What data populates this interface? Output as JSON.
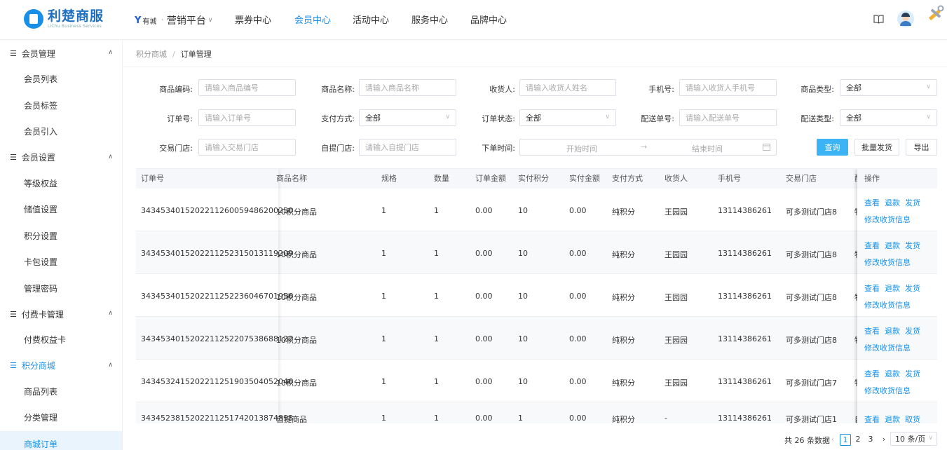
{
  "header": {
    "logo_text": "利楚商服",
    "logo_sub": "LiChu Business Services",
    "brand_mark": "Y",
    "brand_name": "有城",
    "platform": "营销平台",
    "nav": [
      "票券中心",
      "会员中心",
      "活动中心",
      "服务中心",
      "品牌中心"
    ],
    "active_nav": "会员中心",
    "icons": [
      "book-icon",
      "avatar",
      "tools-icon"
    ]
  },
  "sidebar": {
    "groups": [
      {
        "label": "会员管理",
        "items": [
          "会员列表",
          "会员标签",
          "会员引入"
        ]
      },
      {
        "label": "会员设置",
        "items": [
          "等级权益",
          "储值设置",
          "积分设置",
          "卡包设置",
          "管理密码"
        ]
      },
      {
        "label": "付费卡管理",
        "items": [
          "付费权益卡"
        ]
      },
      {
        "label": "积分商城",
        "items": [
          "商品列表",
          "分类管理",
          "商城订单"
        ]
      }
    ],
    "active_group": "积分商城",
    "active_item": "商城订单"
  },
  "breadcrumb": {
    "parent": "积分商城",
    "separator": "/",
    "current": "订单管理"
  },
  "filters": {
    "goods_code": {
      "label": "商品编码:",
      "placeholder": "请输入商品编号"
    },
    "goods_name": {
      "label": "商品名称:",
      "placeholder": "请输入商品名称"
    },
    "receiver": {
      "label": "收货人:",
      "placeholder": "请输入收货人姓名"
    },
    "phone": {
      "label": "手机号:",
      "placeholder": "请输入收货人手机号"
    },
    "goods_type": {
      "label": "商品类型:",
      "value": "全部"
    },
    "order_no": {
      "label": "订单号:",
      "placeholder": "请输入订单号"
    },
    "pay_method": {
      "label": "支付方式:",
      "value": "全部"
    },
    "order_status": {
      "label": "订单状态:",
      "value": "全部"
    },
    "delivery_no": {
      "label": "配送单号:",
      "placeholder": "请输入配送单号"
    },
    "delivery_type": {
      "label": "配送类型:",
      "value": "全部"
    },
    "trade_store": {
      "label": "交易门店:",
      "placeholder": "请输入交易门店"
    },
    "pickup_store": {
      "label": "自提门店:",
      "placeholder": "请输入自提门店"
    },
    "order_time": {
      "label": "下单时间:",
      "start": "开始时间",
      "arrow": "→",
      "end": "结束时间"
    }
  },
  "buttons": {
    "query": "查询",
    "batch_ship": "批量发货",
    "export": "导出"
  },
  "table": {
    "columns": [
      "订单号",
      "商品名称",
      "规格",
      "数量",
      "订单金额",
      "实付积分",
      "实付金额",
      "支付方式",
      "收货人",
      "手机号",
      "交易门店",
      "配送",
      "操作"
    ],
    "rows": [
      [
        "343453401520221126005948620025​0",
        "10积分商品",
        "1",
        "1",
        "0.00",
        "10",
        "0.00",
        "纯积分",
        "王园园",
        "13114386261",
        "可多测试门店8",
        "物"
      ],
      [
        "343453401520221125231501311920​9",
        "10积分商品",
        "1",
        "1",
        "0.00",
        "10",
        "0.00",
        "纯积分",
        "王园园",
        "13114386261",
        "可多测试门店8",
        "物"
      ],
      [
        "343453401520221125223604670195​6",
        "10积分商品",
        "1",
        "1",
        "0.00",
        "10",
        "0.00",
        "纯积分",
        "王园园",
        "13114386261",
        "可多测试门店8",
        "物"
      ],
      [
        "343453401520221125220753868812​2",
        "10积分商品",
        "1",
        "1",
        "0.00",
        "10",
        "0.00",
        "纯积分",
        "王园园",
        "13114386261",
        "可多测试门店8",
        "物"
      ],
      [
        "343453241520221125190350405204​6",
        "10积分商品",
        "1",
        "1",
        "0.00",
        "10",
        "0.00",
        "纯积分",
        "王园园",
        "13114386261",
        "可多测试门店7",
        "物"
      ],
      [
        "343452381520221125174201387489​8",
        "自提商品",
        "1",
        "1",
        "0.00",
        "1",
        "0.00",
        "纯积分",
        "-",
        "13114386261",
        "可多测试门店1",
        "自"
      ]
    ],
    "ops": [
      [
        "查看",
        "退款",
        "发货",
        "修改收货信息"
      ],
      [
        "查看",
        "退款",
        "发货",
        "修改收货信息"
      ],
      [
        "查看",
        "退款",
        "发货",
        "修改收货信息"
      ],
      [
        "查看",
        "退款",
        "发货",
        "修改收货信息"
      ],
      [
        "查看",
        "退款",
        "发货",
        "修改收货信息"
      ],
      [
        "查看",
        "退款",
        "取货",
        ""
      ]
    ]
  },
  "pagination": {
    "total_text": "共 26 条数据",
    "prev": "‹",
    "pages": [
      "1",
      "2",
      "3"
    ],
    "current": "1",
    "next": "›",
    "page_size": "10 条/页"
  },
  "colors": {
    "accent": "#1890e8",
    "primary_btn": "#3bb3f5"
  }
}
